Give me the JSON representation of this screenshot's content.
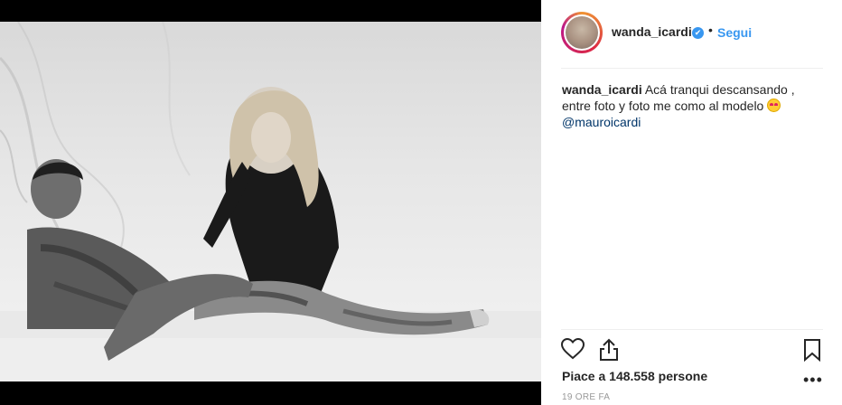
{
  "post": {
    "image_alt": "Black and white photo",
    "bg_color": "#000000"
  },
  "header": {
    "username": "wanda_icardi",
    "verified_mark": "✔",
    "separator": "•",
    "follow_label": "Segui",
    "follow_color": "#3897f0"
  },
  "caption": {
    "username": "wanda_icardi",
    "text": "Acá tranqui descansando , entre foto y foto me como al modelo",
    "emoji": "heart-eyes-emoji",
    "mention": "@mauroicardi"
  },
  "actions": {
    "like_icon": "heart-icon",
    "share_icon": "share-icon",
    "save_icon": "bookmark-icon",
    "more_icon": "more-icon",
    "more_label": "•••"
  },
  "likes": {
    "text": "Piace a 148.558 persone"
  },
  "timestamp": {
    "text": "19 ORE FA"
  }
}
